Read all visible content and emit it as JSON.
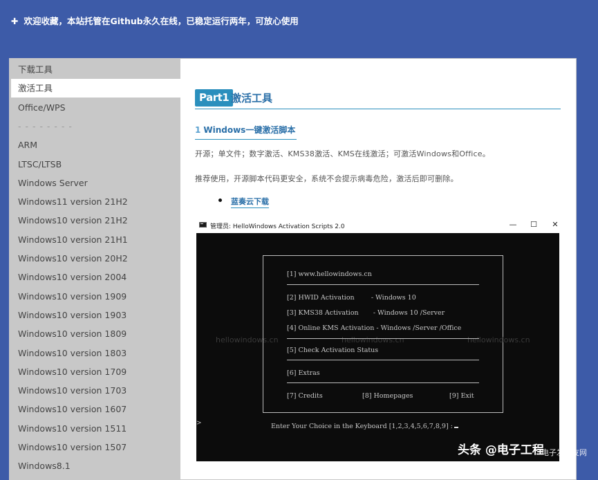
{
  "banner": {
    "icon": "plus-icon",
    "text": "欢迎收藏，本站托管在Github永久在线，已稳定运行两年，可放心使用"
  },
  "colors": {
    "page_bg": "#3d5ba8",
    "sidebar_bg": "#c8c8c8",
    "accent": "#2a8fbd",
    "console_bg": "#0c0c0c"
  },
  "sidebar": {
    "items": [
      {
        "label": "下载工具",
        "active": false
      },
      {
        "label": "激活工具",
        "active": true
      },
      {
        "label": "Office/WPS",
        "active": false
      },
      {
        "label": "- - - - - - - -",
        "active": false
      },
      {
        "label": "ARM",
        "active": false
      },
      {
        "label": "LTSC/LTSB",
        "active": false
      },
      {
        "label": "Windows Server",
        "active": false
      },
      {
        "label": "Windows11 version 21H2",
        "active": false
      },
      {
        "label": "Windows10 version 21H2",
        "active": false
      },
      {
        "label": "Windows10 version 21H1",
        "active": false
      },
      {
        "label": "Windows10 version 20H2",
        "active": false
      },
      {
        "label": "Windows10 version 2004",
        "active": false
      },
      {
        "label": "Windows10 version 1909",
        "active": false
      },
      {
        "label": "Windows10 version 1903",
        "active": false
      },
      {
        "label": "Windows10 version 1809",
        "active": false
      },
      {
        "label": "Windows10 version 1803",
        "active": false
      },
      {
        "label": "Windows10 version 1709",
        "active": false
      },
      {
        "label": "Windows10 version 1703",
        "active": false
      },
      {
        "label": "Windows10 version 1607",
        "active": false
      },
      {
        "label": "Windows10 version 1511",
        "active": false
      },
      {
        "label": "Windows10 version 1507",
        "active": false
      },
      {
        "label": "Windows8.1",
        "active": false
      }
    ]
  },
  "main": {
    "part_badge": "Part1",
    "part_title": "激活工具",
    "section_number": "1",
    "section_title": "Windows一键激活脚本",
    "desc1": "开源；单文件；数字激活、KMS38激活、KMS在线激活；可激活Windows和Office。",
    "desc2": "推荐使用，开源脚本代码更安全，系统不会提示病毒危险，激活后即可删除。",
    "download_link": "蓝奏云下载"
  },
  "console_window": {
    "title": "管理员:  HelloWindows Activation Scripts 2.0",
    "minimize": "—",
    "maximize": "☐",
    "close": "✕",
    "menu": {
      "site": "[1] www.hellowindows.cn",
      "hwid": "[2] HWID Activation        - Windows 10",
      "kms38": "[3] KMS38 Activation       - Windows 10 /Server",
      "online_kms": "[4] Online KMS Activation - Windows /Server /Office",
      "check": "[5] Check Activation Status",
      "extras": "[6] Extras",
      "credits": "[7] Credits",
      "homepages": "[8] Homepages",
      "exit": "[9] Exit"
    },
    "watermark": "hellowindows.cn",
    "prompt": "Enter Your Choice in the Keyboard [1,2,3,4,5,6,7,8,9] :",
    "edge_mark": ">"
  },
  "credit": {
    "main": "头条 @电子工程",
    "small": "电子发烧友网"
  }
}
